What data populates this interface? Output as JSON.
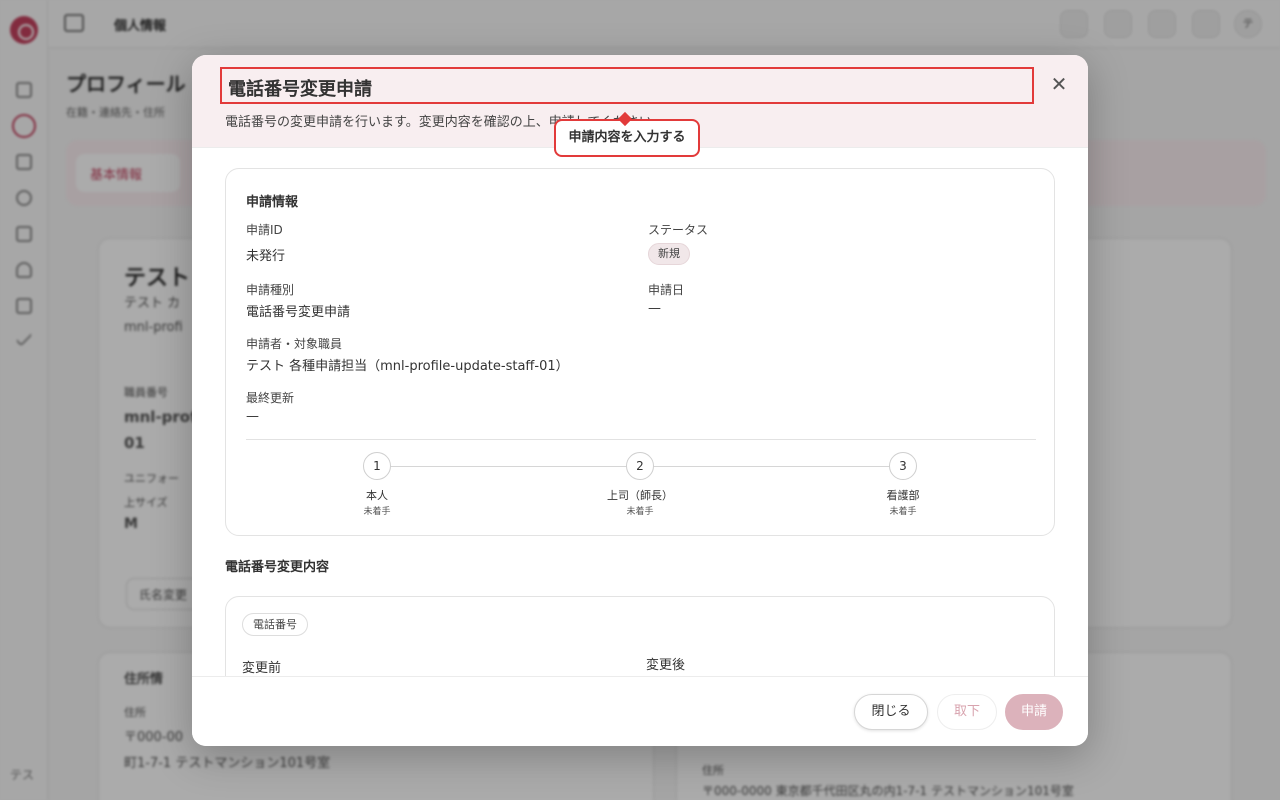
{
  "background": {
    "breadcrumb": "個人情報",
    "page_title": "プロフィール",
    "page_subtitle": "在籍・連絡先・住所",
    "tab_basic": "基本情報",
    "profile_name": "テスト",
    "profile_kana": "テスト カ",
    "profile_id": "mnl-profi",
    "staff_no_label": "職員番号",
    "staff_no_value": "mnl-prof",
    "staff_no_value2": "01",
    "uniform_label": "ユニフォー",
    "uniform_size_label": "上サイズ",
    "uniform_size_value": "M",
    "name_change_button": "氏名変更",
    "address_section": "住所情",
    "address_label": "住所",
    "address_zip": "〒000-00",
    "address_line": "町1-7-1 テストマンション101号室",
    "address_label_right": "住所",
    "address_line_right": "〒000-0000 東京都千代田区丸の内1-7-1 テストマンション101号室",
    "user_initials": "テス",
    "topbar_user": "テ"
  },
  "dialog": {
    "title": "電話番号変更申請",
    "description": "電話番号の変更申請を行います。変更内容を確認の上、申請してください。",
    "callout": "申請内容を入力する",
    "info_section_title": "申請情報",
    "fields": {
      "id_label": "申請ID",
      "id_value": "未発行",
      "status_label": "ステータス",
      "status_value": "新規",
      "type_label": "申請種別",
      "type_value": "電話番号変更申請",
      "date_label": "申請日",
      "date_value": "—",
      "applicant_label": "申請者・対象職員",
      "applicant_value": "テスト 各種申請担当（mnl-profile-update-staff-01）",
      "updated_label": "最終更新",
      "updated_value": "—"
    },
    "steps": [
      {
        "number": "1",
        "label": "本人",
        "status": "未着手"
      },
      {
        "number": "2",
        "label": "上司（師長）",
        "status": "未着手"
      },
      {
        "number": "3",
        "label": "看護部",
        "status": "未着手"
      }
    ],
    "change_section_title": "電話番号変更内容",
    "phone_chip": "電話番号",
    "before_label": "変更前",
    "after_label": "変更後",
    "buttons": {
      "close": "閉じる",
      "withdraw": "取下",
      "apply": "申請"
    }
  }
}
